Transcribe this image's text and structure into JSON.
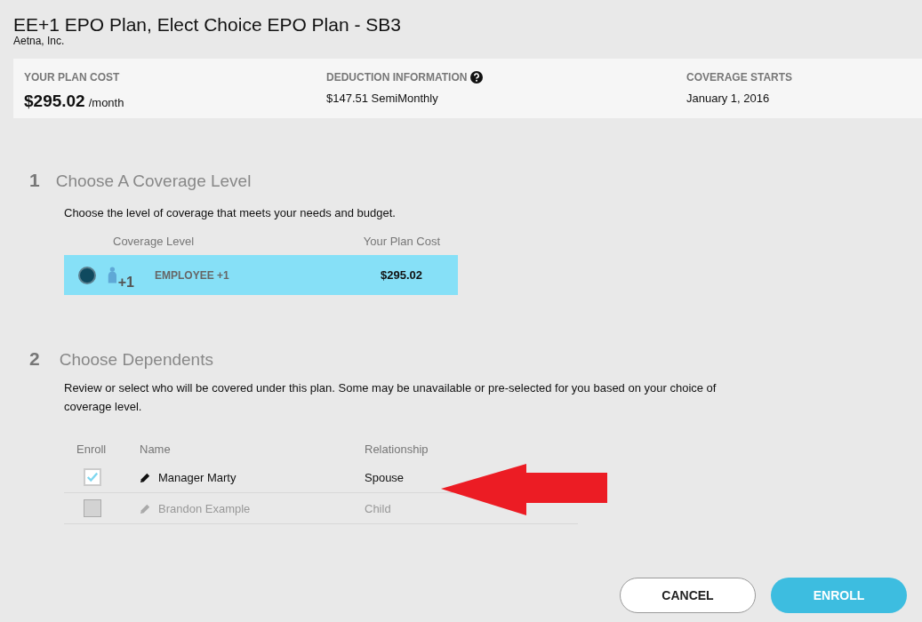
{
  "title": "EE+1 EPO Plan, Elect Choice EPO Plan - SB3",
  "carrier": "Aetna, Inc.",
  "summary": {
    "plan_cost_label": "YOUR PLAN COST",
    "plan_cost": "$295.02",
    "plan_cost_unit": "/month",
    "deduction_label": "DEDUCTION INFORMATION",
    "deduction": "$147.51 SemiMonthly",
    "coverage_label": "COVERAGE STARTS",
    "coverage": "January 1, 2016"
  },
  "step1": {
    "number": "1",
    "heading": "Choose A Coverage Level",
    "description": "Choose the level of coverage that meets your needs and budget.",
    "columns": [
      "Coverage Level",
      "Your Plan Cost"
    ],
    "options": [
      {
        "badge": "+1",
        "label": "EMPLOYEE +1",
        "cost": "$295.02",
        "selected": true
      }
    ]
  },
  "step2": {
    "number": "2",
    "heading": "Choose Dependents",
    "description": "Review or select who will be covered under this plan. Some may be unavailable or pre-selected for you based on your choice of coverage level.",
    "columns": [
      "Enroll",
      "Name",
      "Relationship"
    ],
    "dependents": [
      {
        "name": "Manager Marty",
        "relationship": "Spouse",
        "checked": true,
        "disabled": false
      },
      {
        "name": "Brandon Example",
        "relationship": "Child",
        "checked": false,
        "disabled": true
      }
    ]
  },
  "buttons": {
    "cancel": "CANCEL",
    "enroll": "ENROLL"
  }
}
